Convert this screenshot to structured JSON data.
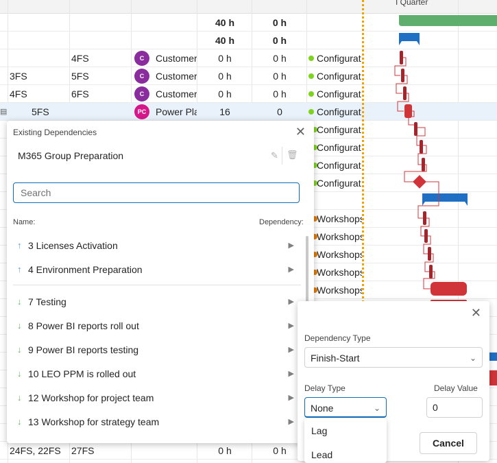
{
  "timeline": {
    "quarter_label": "I Quarter"
  },
  "summary_rows": [
    {
      "work": "40 h",
      "remaining": "0 h"
    },
    {
      "work": "40 h",
      "remaining": "0 h"
    }
  ],
  "task_rows": [
    {
      "pred": "",
      "succ": "4FS",
      "avatar": "C",
      "avatar_color": "#8a2c9e",
      "resource": "Customer",
      "work": "0 h",
      "remaining": "0 h",
      "bucket": "Configurat",
      "dot_color": "#7ed321"
    },
    {
      "pred": "3FS",
      "succ": "5FS",
      "avatar": "C",
      "avatar_color": "#8a2c9e",
      "resource": "Customer",
      "work": "0 h",
      "remaining": "0 h",
      "bucket": "Configurat",
      "dot_color": "#7ed321"
    },
    {
      "pred": "4FS",
      "succ": "6FS",
      "avatar": "C",
      "avatar_color": "#8a2c9e",
      "resource": "Customer",
      "work": "0 h",
      "remaining": "0 h",
      "bucket": "Configurat",
      "dot_color": "#7ed321"
    },
    {
      "pred": "5FS",
      "succ": "",
      "avatar": "PC",
      "avatar_color": "#d6178a",
      "resource": "Power Pla",
      "work": "16",
      "remaining": "0",
      "bucket": "Configurat",
      "dot_color": "#7ed321"
    }
  ],
  "bucket_rows": [
    {
      "bucket": "Configurat",
      "dot_color": "#7ed321"
    },
    {
      "bucket": "Configurat",
      "dot_color": "#7ed321"
    },
    {
      "bucket": "Configurat",
      "dot_color": "#7ed321"
    },
    {
      "bucket": "Configurat",
      "dot_color": "#7ed321"
    },
    {
      "bucket": "Workshops",
      "dot_color": "#e07b00"
    },
    {
      "bucket": "Workshops",
      "dot_color": "#e07b00"
    },
    {
      "bucket": "Workshops",
      "dot_color": "#e07b00"
    },
    {
      "bucket": "Workshops",
      "dot_color": "#e07b00"
    },
    {
      "bucket": "Workshops",
      "dot_color": "#e07b00"
    }
  ],
  "bottom_row": {
    "pred": "24FS, 22FS",
    "succ": "27FS",
    "work": "0 h",
    "remaining": "0 h"
  },
  "dependencies_panel": {
    "title": "Existing Dependencies",
    "task_name": "M365 Group Preparation",
    "search_placeholder": "Search",
    "col_name": "Name:",
    "col_dependency": "Dependency:",
    "predecessors": [
      {
        "label": "3 Licenses Activation",
        "icon": "arrow-up-icon"
      },
      {
        "label": "4 Environment Preparation",
        "icon": "arrow-up-icon"
      }
    ],
    "successors": [
      {
        "label": "7 Testing",
        "icon": "arrow-down-icon"
      },
      {
        "label": "8 Power BI reports roll out",
        "icon": "arrow-down-icon"
      },
      {
        "label": "9 Power BI reports testing",
        "icon": "arrow-down-icon"
      },
      {
        "label": "10 LEO PPM is rolled out",
        "icon": "arrow-down-icon"
      },
      {
        "label": "12 Workshop for project team",
        "icon": "arrow-down-icon"
      },
      {
        "label": "13 Workshop for strategy team",
        "icon": "arrow-down-icon"
      }
    ]
  },
  "dependency_dialog": {
    "type_label": "Dependency Type",
    "type_value": "Finish-Start",
    "delay_type_label": "Delay Type",
    "delay_type_value": "None",
    "delay_value_label": "Delay Value",
    "delay_value": "0",
    "cancel_label": "Cancel",
    "delay_options": [
      "Lag",
      "Lead"
    ]
  },
  "colors": {
    "accent": "#0f6cbd",
    "summary_green": "#5fae6e",
    "summary_blue": "#1f6fc5",
    "task_red": "#d13438",
    "today_line": "#f0a300"
  }
}
